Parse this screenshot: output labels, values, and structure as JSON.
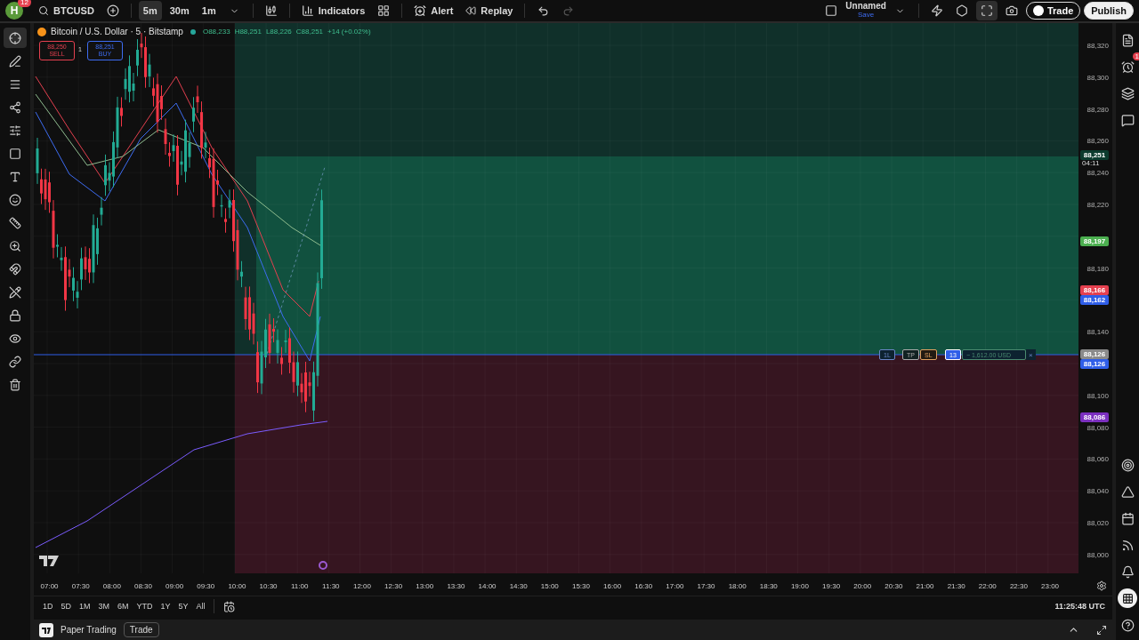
{
  "top_bar": {
    "avatar": {
      "letter": "H",
      "badge": "12"
    },
    "symbol": "BTCUSD",
    "intervals": [
      {
        "label": "5m",
        "selected": true
      },
      {
        "label": "30m",
        "selected": false
      },
      {
        "label": "1m",
        "selected": false
      }
    ],
    "indicators": "Indicators",
    "alert": "Alert",
    "replay": "Replay",
    "layout": {
      "name": "Unnamed",
      "status": "Save"
    },
    "trade": "Trade",
    "publish": "Publish"
  },
  "legend": {
    "title": "Bitcoin / U.S. Dollar · 5 · Bitstamp",
    "ohlc": [
      {
        "key": "O",
        "value": "88,233"
      },
      {
        "key": "H",
        "value": "88,251"
      },
      {
        "key": "L",
        "value": "88,226"
      },
      {
        "key": "C",
        "value": "88,251"
      }
    ],
    "change": "+14 (+0.02%)"
  },
  "order_buttons": {
    "sell": {
      "price": "88,250",
      "label": "SELL"
    },
    "buy": {
      "price": "88,251",
      "label": "BUY"
    },
    "spread": "1"
  },
  "position": {
    "quantity": "1L",
    "tp": "TP",
    "sl": "SL",
    "count": "13",
    "pnl": "− 1,612.00 USD",
    "close": "×"
  },
  "price_axis": {
    "ticks": [
      "88,320",
      "88,300",
      "88,280",
      "88,260",
      "88,240",
      "88,220",
      "88,180",
      "88,140",
      "88,100",
      "88,080",
      "88,060",
      "88,040",
      "88,020",
      "88,000"
    ],
    "markers": [
      {
        "value": "88,251",
        "sub": "04:11",
        "color": "#0c3b2e"
      },
      {
        "value": "88,197",
        "color": "#4caf50"
      },
      {
        "value": "88,166",
        "color": "#e5404f"
      },
      {
        "value": "88,162",
        "color": "#2f5ee8"
      },
      {
        "value": "88,126",
        "color": "#8a8a8a"
      },
      {
        "value": "88,126",
        "color": "#2f5ee8"
      },
      {
        "value": "88,086",
        "color": "#7b2fbf"
      }
    ]
  },
  "time_axis": [
    "07:00",
    "07:30",
    "08:00",
    "08:30",
    "09:00",
    "09:30",
    "10:00",
    "10:30",
    "11:00",
    "11:30",
    "12:00",
    "12:30",
    "13:00",
    "13:30",
    "14:00",
    "14:30",
    "15:00",
    "15:30",
    "16:00",
    "16:30",
    "17:00",
    "17:30",
    "18:00",
    "18:30",
    "19:00",
    "19:30",
    "20:00",
    "20:30",
    "21:00",
    "21:30",
    "22:00",
    "22:30",
    "23:00"
  ],
  "ranges": [
    "1D",
    "5D",
    "1M",
    "3M",
    "6M",
    "YTD",
    "1Y",
    "5Y",
    "All"
  ],
  "clock": "11:25:48 UTC",
  "bottom_panel": {
    "title": "Paper Trading",
    "button": "Trade"
  },
  "right_bar": {
    "alerts_badge": "1"
  }
}
